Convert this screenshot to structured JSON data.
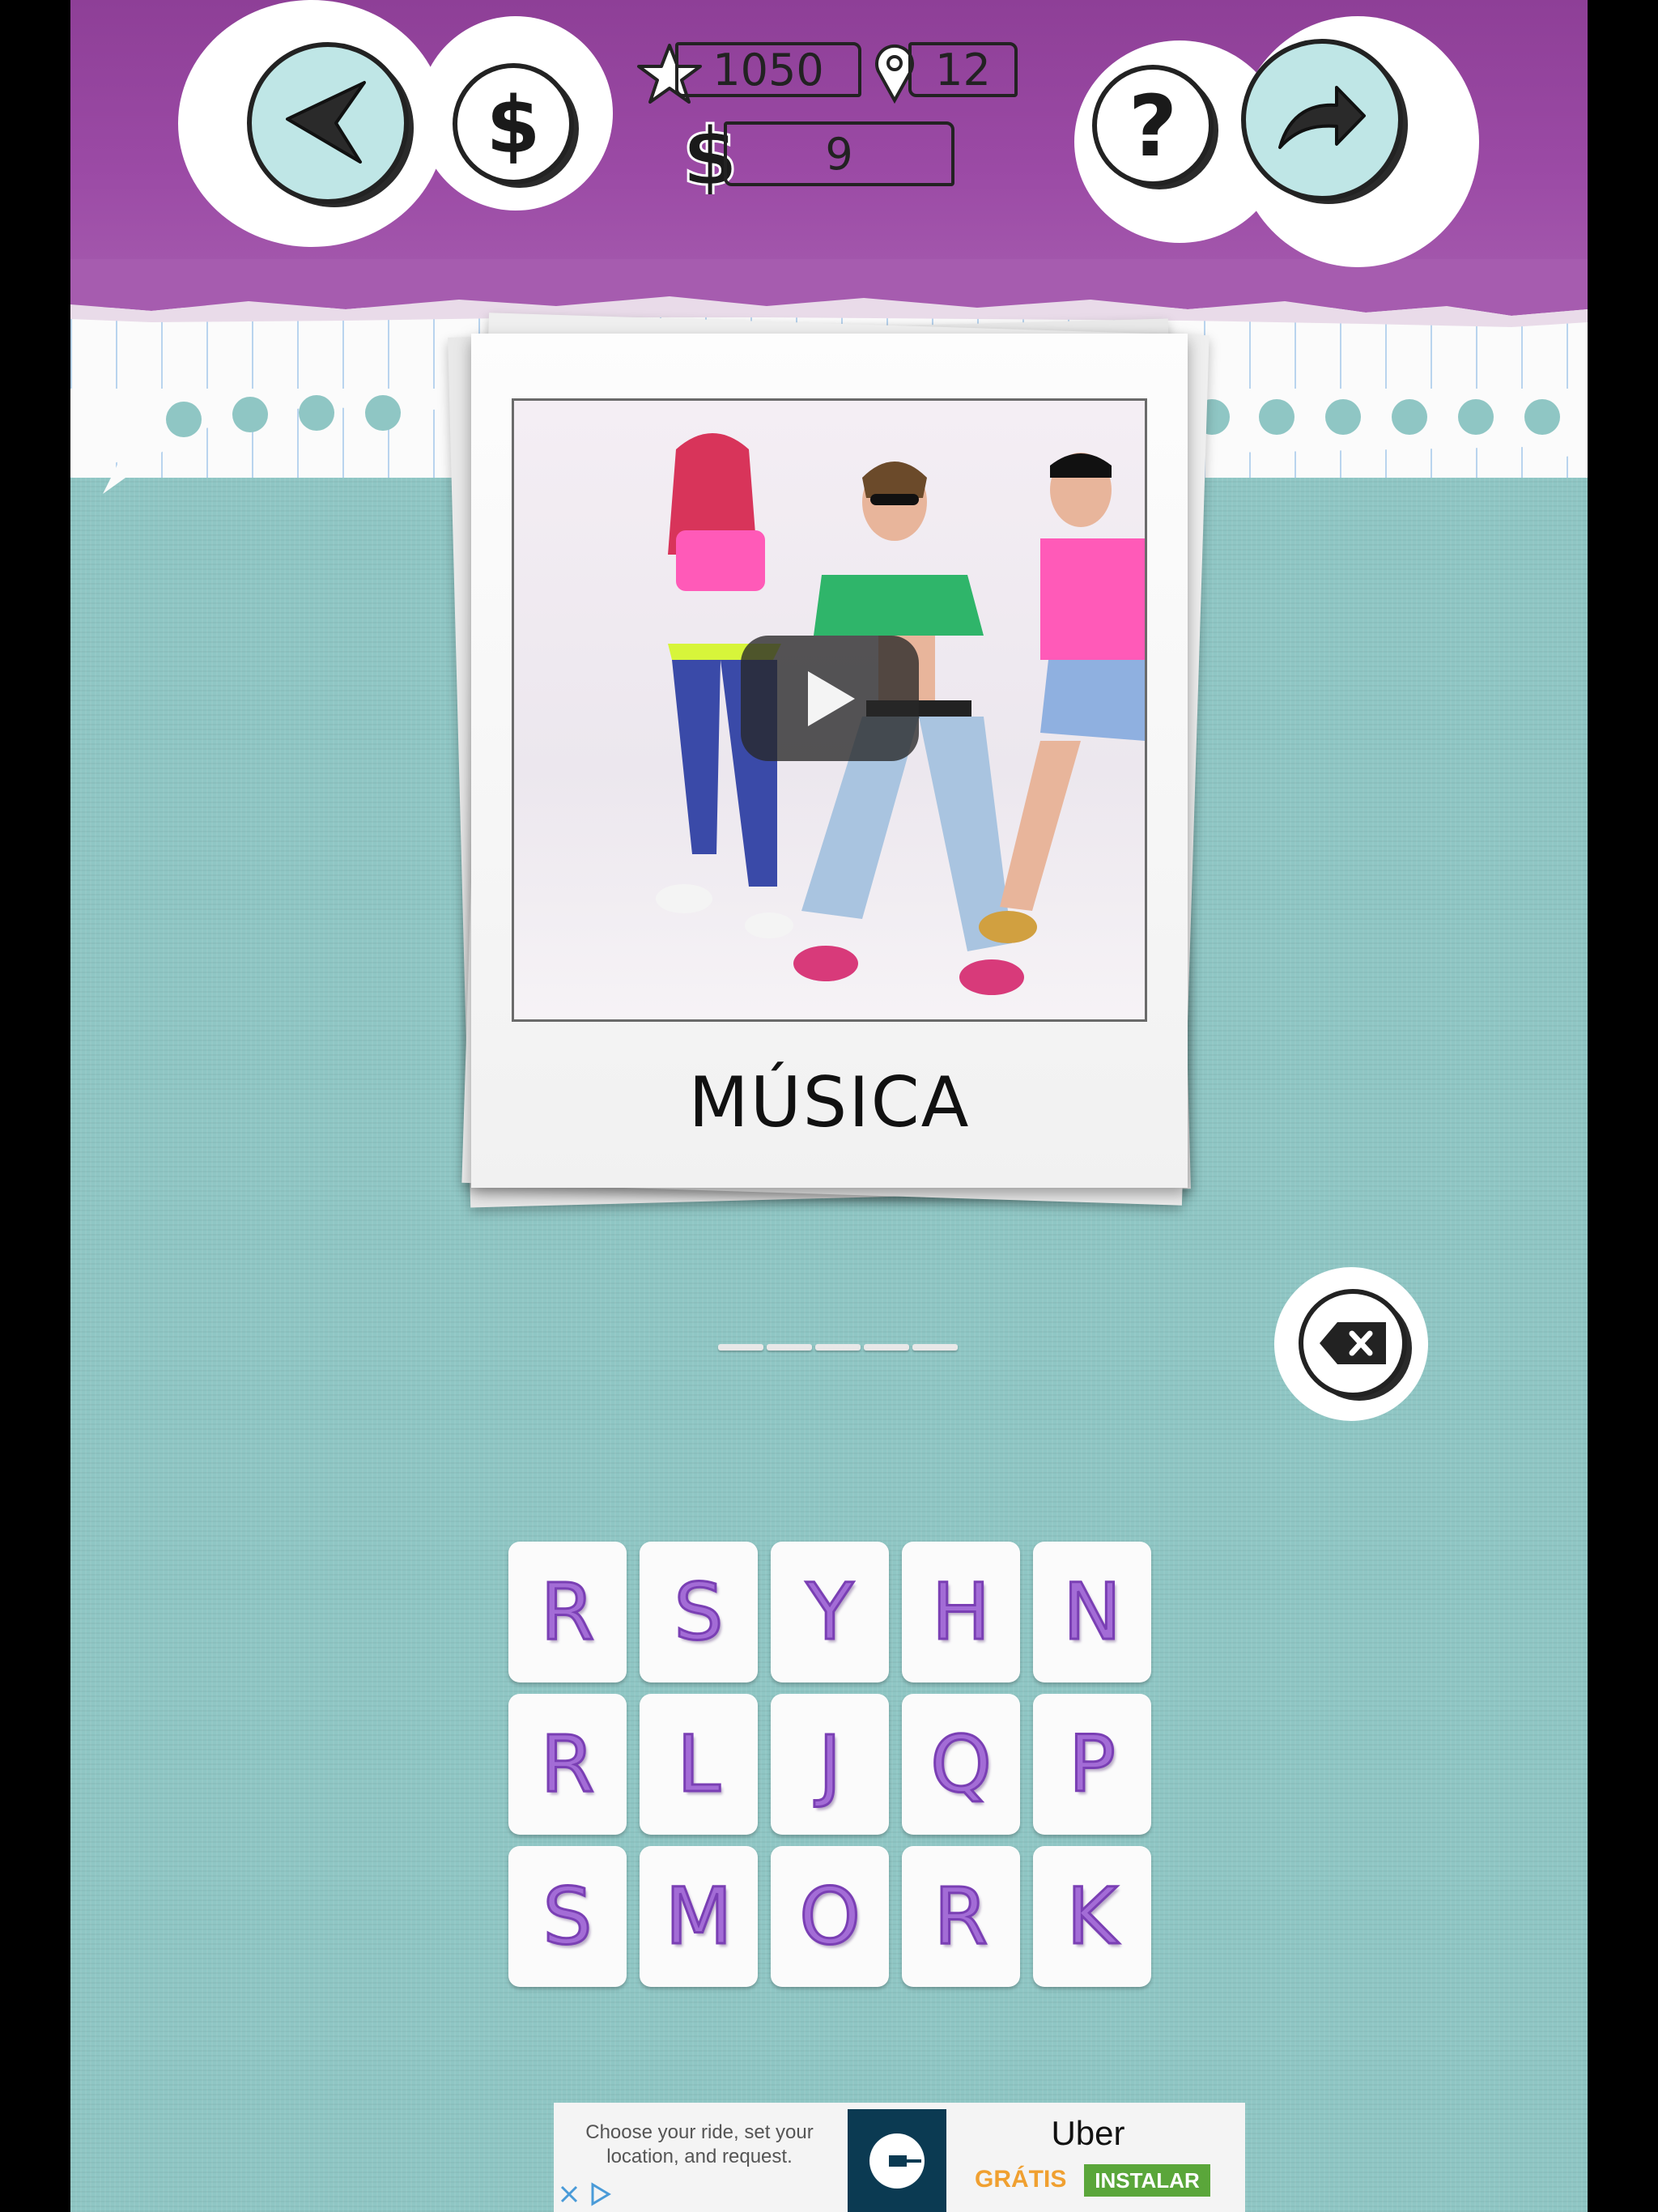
{
  "hud": {
    "stars": "1050",
    "level": "12",
    "coins": "9",
    "back_icon": "back-arrow-icon",
    "shop_icon": "dollar-icon",
    "hint_icon": "question-icon",
    "skip_icon": "forward-arrow-icon"
  },
  "puzzle": {
    "category": "MÚSICA",
    "answer_slot_count": 5,
    "media": "video-thumbnail"
  },
  "letters": [
    "R",
    "S",
    "Y",
    "H",
    "N",
    "R",
    "L",
    "J",
    "Q",
    "P",
    "S",
    "M",
    "O",
    "R",
    "K"
  ],
  "ad": {
    "text": "Choose your ride, set your location, and request.",
    "brand": "Uber",
    "free_label": "GRÁTIS",
    "install_label": "INSTALAR"
  },
  "colors": {
    "header_purple": "#9547a0",
    "background_teal": "#8fc6c4",
    "letter_purple": "#a36cd6",
    "ad_install_green": "#5aa63a"
  }
}
